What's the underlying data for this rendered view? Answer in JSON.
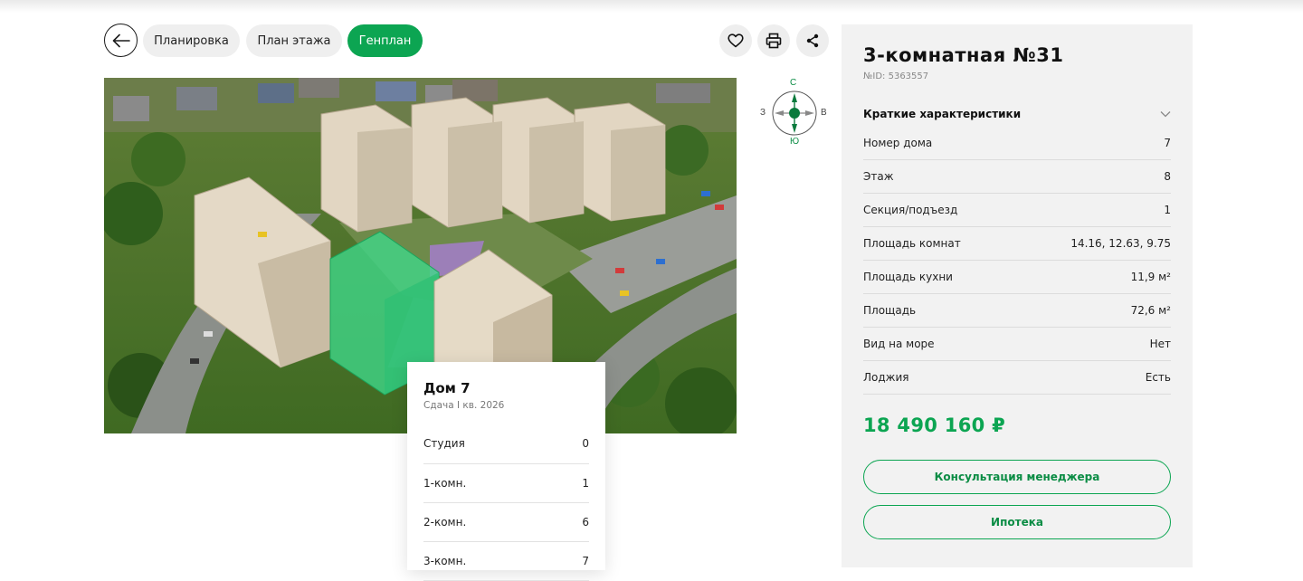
{
  "nav": {
    "tabs": [
      {
        "label": "Планировка"
      },
      {
        "label": "План этажа"
      },
      {
        "label": "Генплан"
      }
    ]
  },
  "compass": {
    "north": "С",
    "south": "Ю",
    "west": "З",
    "east": "В"
  },
  "house_card": {
    "title": "Дом 7",
    "subtitle": "Сдача I кв. 2026",
    "rows": [
      {
        "label": "Студия",
        "value": "0"
      },
      {
        "label": "1-комн.",
        "value": "1"
      },
      {
        "label": "2-комн.",
        "value": "6"
      },
      {
        "label": "3-комн.",
        "value": "7"
      }
    ]
  },
  "apartment": {
    "title": "3-комнатная №31",
    "id_label": "№ID: 5363557",
    "characteristics_title": "Краткие характеристики",
    "specs": [
      {
        "label": "Номер дома",
        "value": "7"
      },
      {
        "label": "Этаж",
        "value": "8"
      },
      {
        "label": "Секция/подъезд",
        "value": "1"
      },
      {
        "label": "Площадь комнат",
        "value": "14.16, 12.63, 9.75"
      },
      {
        "label": "Площадь кухни",
        "value": "11,9 м²"
      },
      {
        "label": "Площадь",
        "value": "72,6 м²"
      },
      {
        "label": "Вид на море",
        "value": "Нет"
      },
      {
        "label": "Лоджия",
        "value": "Есть"
      }
    ],
    "price": "18 490 160 ₽",
    "buttons": {
      "consult": "Консультация менеджера",
      "mortgage": "Ипотека"
    }
  },
  "colors": {
    "accent": "#0ca552",
    "highlight": "#3fd88a"
  }
}
